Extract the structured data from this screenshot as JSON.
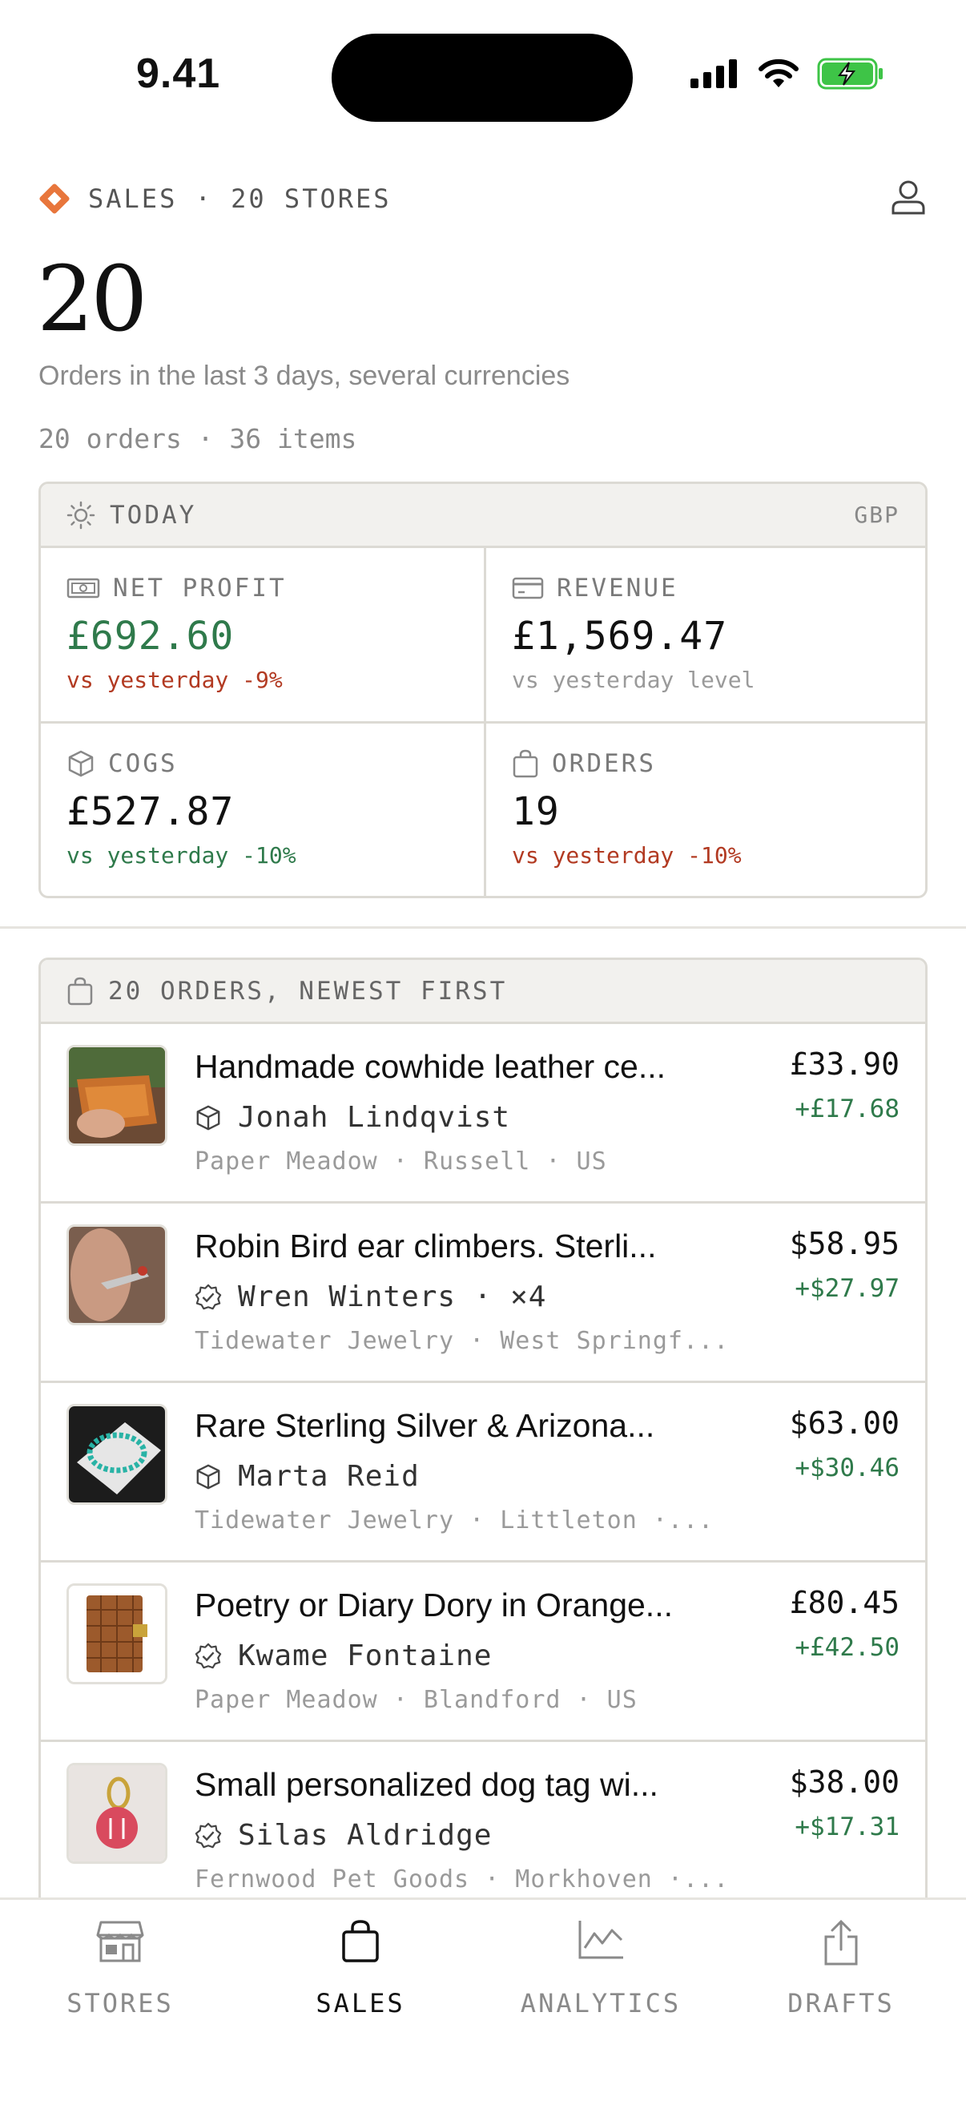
{
  "status_bar": {
    "time": "9.41"
  },
  "header": {
    "title": "SALES · 20 STORES"
  },
  "summary": {
    "count": "20",
    "subtitle": "Orders in the last 3 days, several currencies",
    "meta": "20 orders · 36 items"
  },
  "today": {
    "label": "TODAY",
    "currency": "GBP",
    "metrics": [
      {
        "label": "NET PROFIT",
        "value": "£692.60",
        "delta": "vs yesterday -9%"
      },
      {
        "label": "REVENUE",
        "value": "£1,569.47",
        "delta": "vs yesterday level"
      },
      {
        "label": "COGS",
        "value": "£527.87",
        "delta": "vs yesterday -10%"
      },
      {
        "label": "ORDERS",
        "value": "19",
        "delta": "vs yesterday -10%"
      }
    ]
  },
  "orders": {
    "header": "20 ORDERS, NEWEST FIRST",
    "items": [
      {
        "title": "Handmade cowhide leather ce...",
        "buyer": "Jonah Lindqvist",
        "store": "Paper Meadow · Russell · US",
        "price": "£33.90",
        "profit": "+£17.68",
        "buyer_icon": "package-icon"
      },
      {
        "title": "Robin Bird ear climbers. Sterli...",
        "buyer": "Wren Winters · ×4",
        "store": "Tidewater Jewelry · West Springf...",
        "price": "$58.95",
        "profit": "+$27.97",
        "buyer_icon": "verified-icon"
      },
      {
        "title": "Rare Sterling Silver & Arizona...",
        "buyer": "Marta Reid",
        "store": "Tidewater Jewelry · Littleton ·...",
        "price": "$63.00",
        "profit": "+$30.46",
        "buyer_icon": "package-icon"
      },
      {
        "title": "Poetry or Diary Dory in Orange...",
        "buyer": "Kwame Fontaine",
        "store": "Paper Meadow · Blandford · US",
        "price": "£80.45",
        "profit": "+£42.50",
        "buyer_icon": "verified-icon"
      },
      {
        "title": "Small personalized dog tag wi...",
        "buyer": "Silas Aldridge",
        "store": "Fernwood Pet Goods · Morkhoven ·...",
        "price": "$38.00",
        "profit": "+$17.31",
        "buyer_icon": "verified-icon"
      }
    ]
  },
  "tabs": [
    {
      "label": "STORES",
      "icon": "store-icon"
    },
    {
      "label": "SALES",
      "icon": "bag-icon",
      "active": true
    },
    {
      "label": "ANALYTICS",
      "icon": "chart-icon"
    },
    {
      "label": "DRAFTS",
      "icon": "share-icon"
    }
  ],
  "colors": {
    "accent_orange": "#e8763c",
    "profit_green": "#2f7a4b",
    "loss_red": "#b23a22",
    "border": "#dcdad4",
    "header_bg": "#f2f1ee"
  }
}
